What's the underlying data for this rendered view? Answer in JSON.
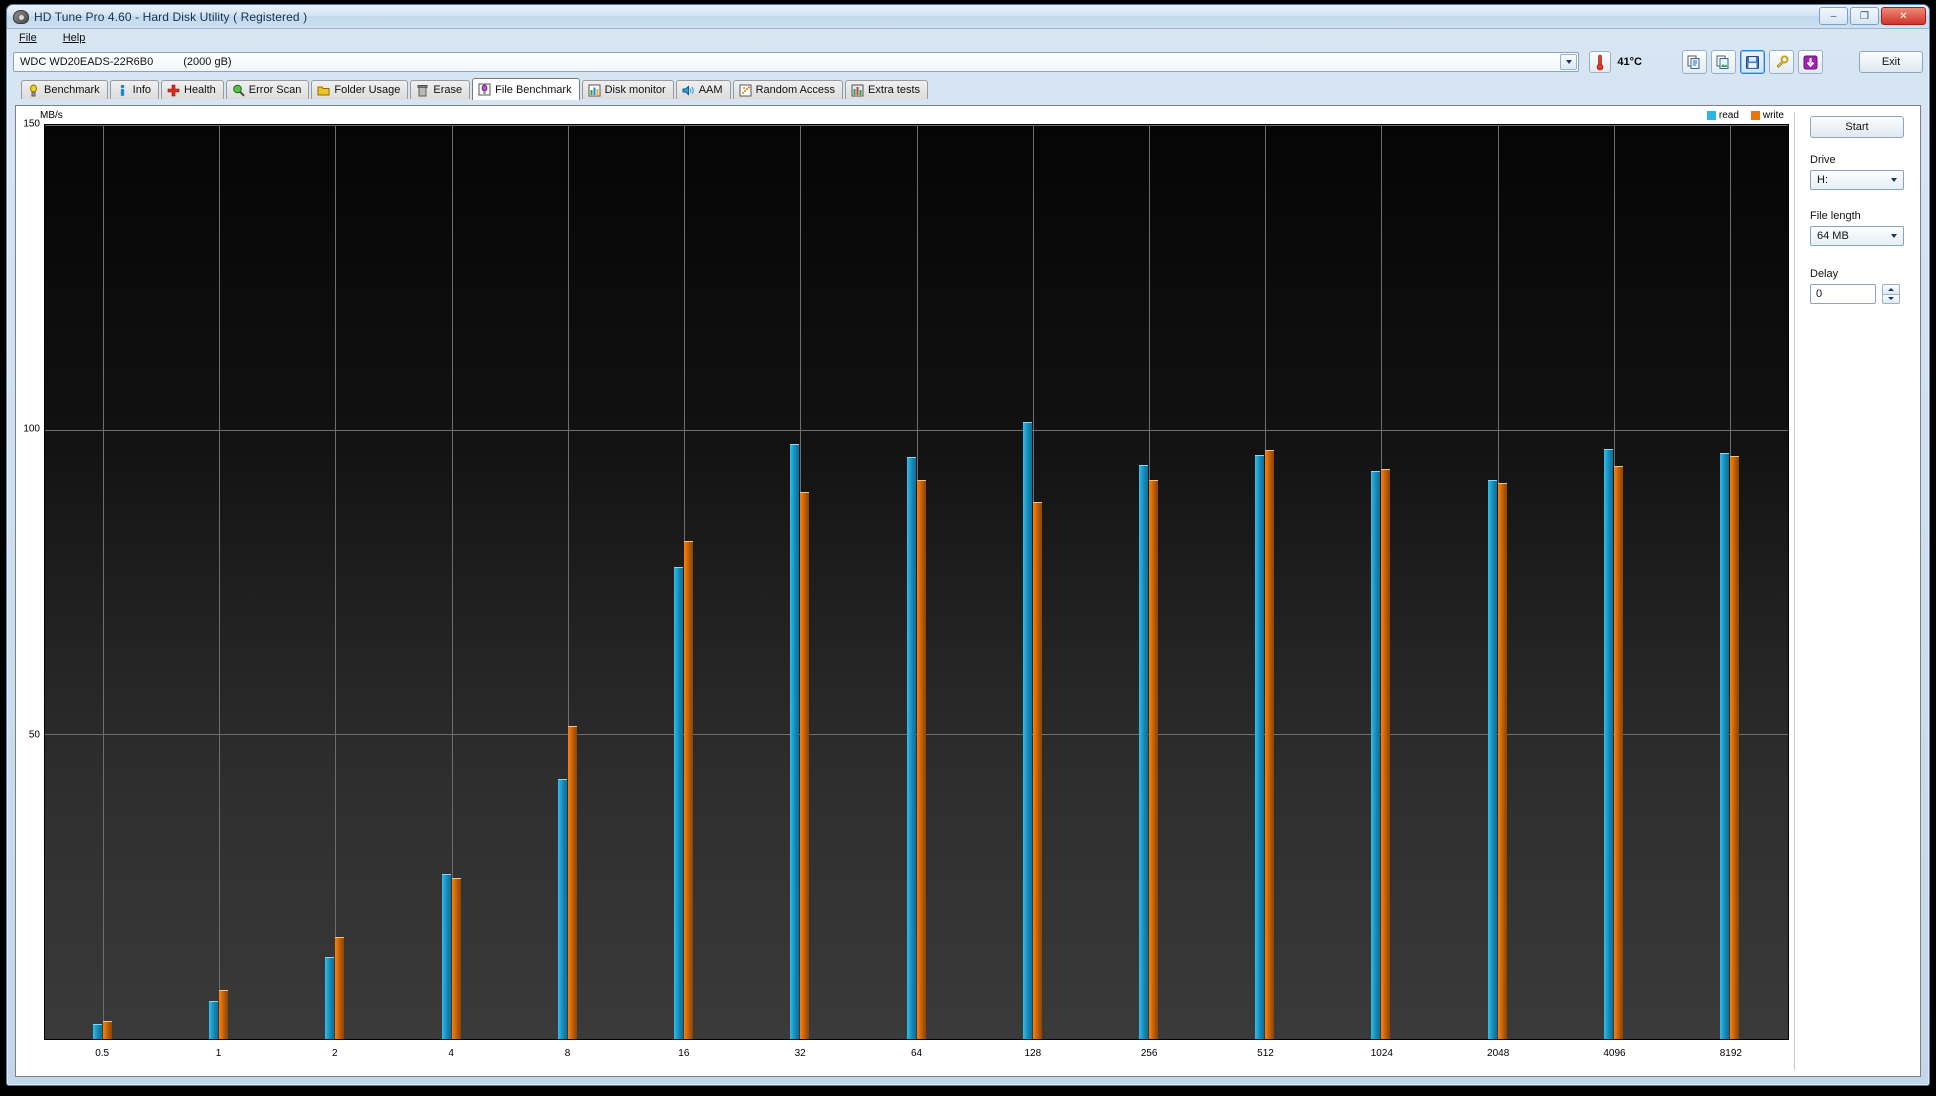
{
  "window": {
    "title": "HD Tune Pro 4.60 - Hard Disk Utility (  Registered )",
    "icon": "hard-disk-icon",
    "minimize": "–",
    "maximize": "❐",
    "close": "✕"
  },
  "menu": {
    "items": [
      {
        "label": "File",
        "accel": "F"
      },
      {
        "label": "Help",
        "accel": "H"
      }
    ]
  },
  "drive_select": {
    "model": "WDC WD20EADS-22R6B0",
    "capacity": "(2000 gB)"
  },
  "toolbar": {
    "temperature": "41°C",
    "temperature_icon": "thermometer-icon",
    "buttons": [
      {
        "name": "copy-text-button",
        "icon": "copy-text-icon",
        "selected": false
      },
      {
        "name": "copy-image-button",
        "icon": "copy-image-icon",
        "selected": false
      },
      {
        "name": "save-button",
        "icon": "floppy-save-icon",
        "selected": true
      },
      {
        "name": "options-button",
        "icon": "tools-icon",
        "selected": false
      },
      {
        "name": "download-button",
        "icon": "download-arrow-icon",
        "selected": false
      }
    ],
    "exit_label": "Exit"
  },
  "tabs": [
    {
      "label": "Benchmark",
      "icon": "yellow-bulb-icon",
      "active": false
    },
    {
      "label": "Info",
      "icon": "blue-info-icon",
      "active": false
    },
    {
      "label": "Health",
      "icon": "red-cross-icon",
      "active": false
    },
    {
      "label": "Error Scan",
      "icon": "magnifier-icon",
      "active": false
    },
    {
      "label": "Folder Usage",
      "icon": "folder-icon",
      "active": false
    },
    {
      "label": "Erase",
      "icon": "trash-icon",
      "active": false
    },
    {
      "label": "File Benchmark",
      "icon": "violet-bulb-icon",
      "active": true
    },
    {
      "label": "Disk monitor",
      "icon": "bar-chart-icon",
      "active": false
    },
    {
      "label": "AAM",
      "icon": "speaker-icon",
      "active": false
    },
    {
      "label": "Random Access",
      "icon": "scatter-icon",
      "active": false
    },
    {
      "label": "Extra tests",
      "icon": "green-chart-icon",
      "active": false
    }
  ],
  "panel": {
    "start_label": "Start",
    "drive_label": "Drive",
    "drive_value": "H:",
    "file_length_label": "File length",
    "file_length_value": "64 MB",
    "delay_label": "Delay",
    "delay_value": "0"
  },
  "colors": {
    "read": "#29b8e5",
    "write": "#e8760b",
    "plot_bg": "#2b2b2b",
    "grid": "#6e6e6e"
  },
  "chart_data": {
    "type": "bar",
    "title": "",
    "unit_label": "MB/s",
    "xlabel": "",
    "ylabel": "MB/s",
    "ylim": [
      0,
      150
    ],
    "yticks": [
      50,
      100,
      150
    ],
    "grid": true,
    "legend_position": "top-right",
    "categories": [
      "0.5",
      "1",
      "2",
      "4",
      "8",
      "16",
      "32",
      "64",
      "128",
      "256",
      "512",
      "1024",
      "2048",
      "4096",
      "8192"
    ],
    "series": [
      {
        "name": "read",
        "color": "#29b8e5",
        "values": [
          2.5,
          6.2,
          13.5,
          27.0,
          42.7,
          77.5,
          97.7,
          95.5,
          101.2,
          94.2,
          95.8,
          93.3,
          91.7,
          96.8,
          96.2
        ]
      },
      {
        "name": "write",
        "color": "#e8760b",
        "values": [
          3.0,
          8.0,
          16.8,
          26.5,
          51.3,
          81.8,
          89.7,
          91.8,
          88.2,
          91.8,
          96.7,
          93.5,
          91.3,
          94.0,
          95.7
        ]
      }
    ]
  }
}
